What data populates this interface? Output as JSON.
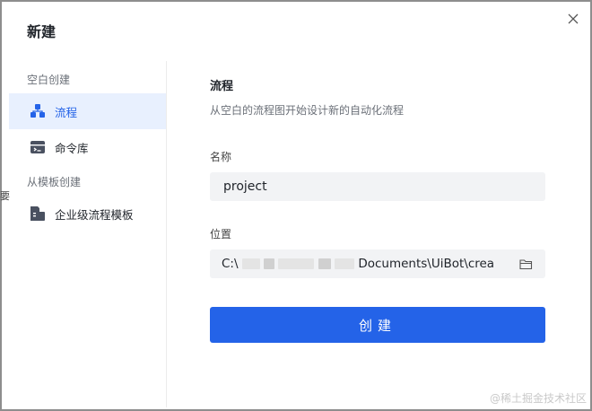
{
  "dialog": {
    "title": "新建",
    "close_glyph": "×"
  },
  "sidebar": {
    "group_blank": "空白创建",
    "group_template": "从模板创建",
    "items": [
      {
        "label": "流程",
        "icon": "flowchart-icon",
        "active": true
      },
      {
        "label": "命令库",
        "icon": "library-icon",
        "active": false
      },
      {
        "label": "企业级流程模板",
        "icon": "template-icon",
        "active": false
      }
    ]
  },
  "main": {
    "section_title": "流程",
    "section_subtitle": "从空白的流程图开始设计新的自动化流程",
    "name_label": "名称",
    "name_value": "project",
    "location_label": "位置",
    "location_prefix": "C:\\",
    "location_suffix": "Documents\\UiBot\\crea",
    "create_label": "创建"
  },
  "watermark": "@稀土掘金技术社区",
  "colors": {
    "accent": "#2463e8",
    "active_bg": "#e8f0fe",
    "field_bg": "#f2f3f5",
    "icon_dark": "#4a5160"
  }
}
